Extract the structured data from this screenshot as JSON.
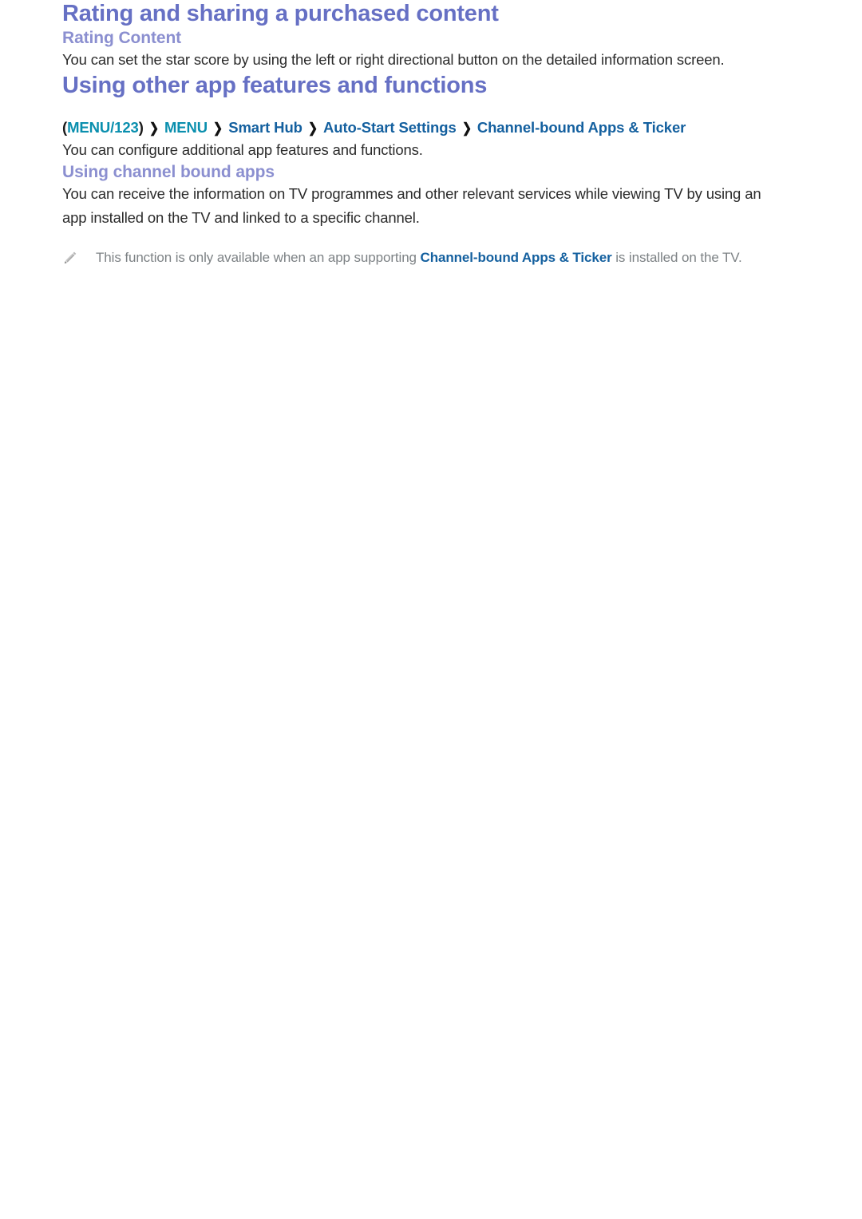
{
  "page": {
    "title": "Rating and sharing a purchased content"
  },
  "rating_section": {
    "subtitle": "Rating Content",
    "paragraph": "You can set the star score by using the left or right directional button on the detailed information screen."
  },
  "app_features_section": {
    "title": "Using other app features and functions",
    "menu_path": {
      "open_paren": "(",
      "close_paren": ")",
      "items": [
        {
          "label": "MENU/123",
          "color": "#0a8fae"
        },
        {
          "label": "MENU",
          "color": "#0a8fae"
        },
        {
          "label": "Smart Hub",
          "color": "#14609f"
        },
        {
          "label": "Auto-Start Settings",
          "color": "#14609f"
        },
        {
          "label": "Channel-bound Apps & Ticker",
          "color": "#14609f"
        }
      ],
      "separator": "❯"
    },
    "paragraph": "You can configure additional app features and functions."
  },
  "channel_bound_section": {
    "subtitle": "Using channel bound apps",
    "paragraph": "You can receive the information on TV programmes and other relevant services while viewing TV by using an app installed on the TV and linked to a specific channel.",
    "note": {
      "icon": "pencil-icon",
      "text_before": "This function is only available when an app supporting ",
      "highlight": "Channel-bound Apps & Ticker",
      "text_after": " is installed on the TV."
    }
  },
  "colors": {
    "heading_purple": "#6670c4",
    "subheading_purple": "#8b8fd0",
    "link_blue": "#14609f",
    "menu_teal": "#0a8fae",
    "body_text": "#2b2b2b",
    "note_text": "#7d8285",
    "background": "#ffffff"
  }
}
